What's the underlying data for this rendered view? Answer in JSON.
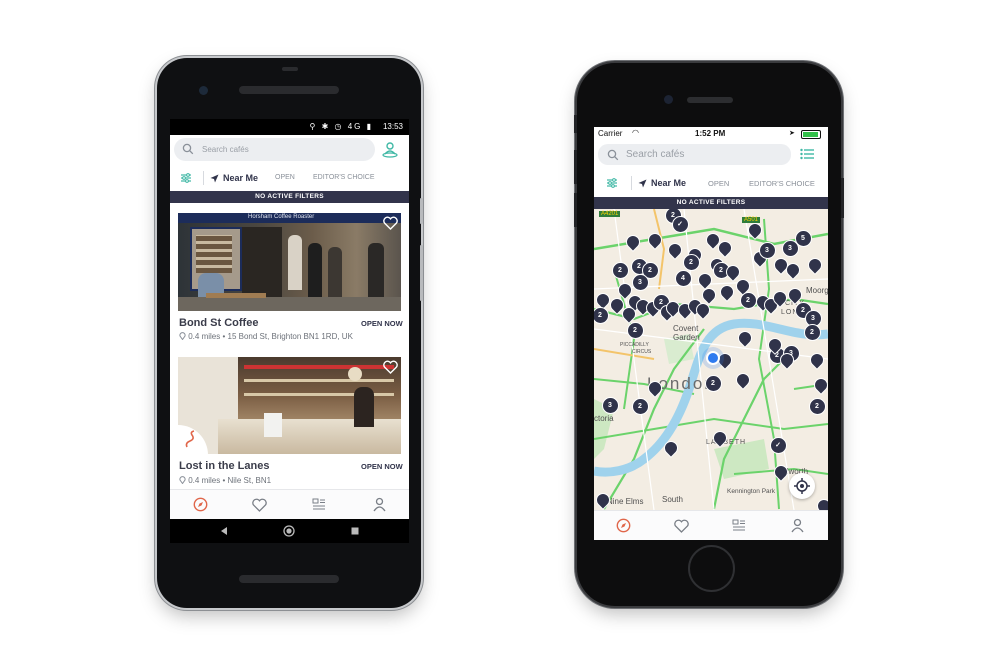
{
  "android": {
    "status": {
      "time": "13:53",
      "network": "4G"
    },
    "search": {
      "placeholder": "Search cafés"
    },
    "filters": {
      "near_me": "Near Me",
      "open": "OPEN",
      "editors_choice": "EDITOR'S CHOICE"
    },
    "banner": "NO ACTIVE FILTERS",
    "cafes": [
      {
        "name": "Bond St Coffee",
        "status": "OPEN NOW",
        "distance": "0.4 miles",
        "address": "15 Bond St, Brighton BN1 1RD, UK",
        "sign": "Horsham Coffee Roaster"
      },
      {
        "name": "Lost in the Lanes",
        "status": "OPEN NOW",
        "distance": "0.4 miles",
        "address": "Nile St, BN1"
      }
    ],
    "tabs": [
      "compass-icon",
      "heart-icon",
      "list-icon",
      "profile-icon"
    ]
  },
  "iphone": {
    "status": {
      "carrier": "Carrier",
      "time": "1:52 PM"
    },
    "search": {
      "placeholder": "Search cafés"
    },
    "filters": {
      "near_me": "Near Me",
      "open": "OPEN",
      "editors_choice": "EDITOR'S CHOICE"
    },
    "banner": "NO ACTIVE FILTERS",
    "map": {
      "labels": {
        "covent_garden_1": "Covent",
        "covent_garden_2": "Garden",
        "piccadilly": "PICCADILLY",
        "circus": "CIRCUS",
        "london": "London",
        "lambeth": "LAMBETH",
        "walworth": "Walworth",
        "kennington": "Kennington Park",
        "south": "South",
        "lambeth2": "Lambeth",
        "nine_elms": "Nine Elms",
        "victoria": "ctoria",
        "city_1": "CITY",
        "city_2": "LONDO",
        "moorgate": "Moorg",
        "road_a4201": "A4201",
        "road_a501": "A501"
      }
    },
    "tabs": [
      "compass-icon",
      "heart-icon",
      "list-icon",
      "profile-icon"
    ]
  },
  "colors": {
    "accent": "#e0664a",
    "navy": "#32344b",
    "teal": "#3fb8a5",
    "pin": "#30334a"
  }
}
